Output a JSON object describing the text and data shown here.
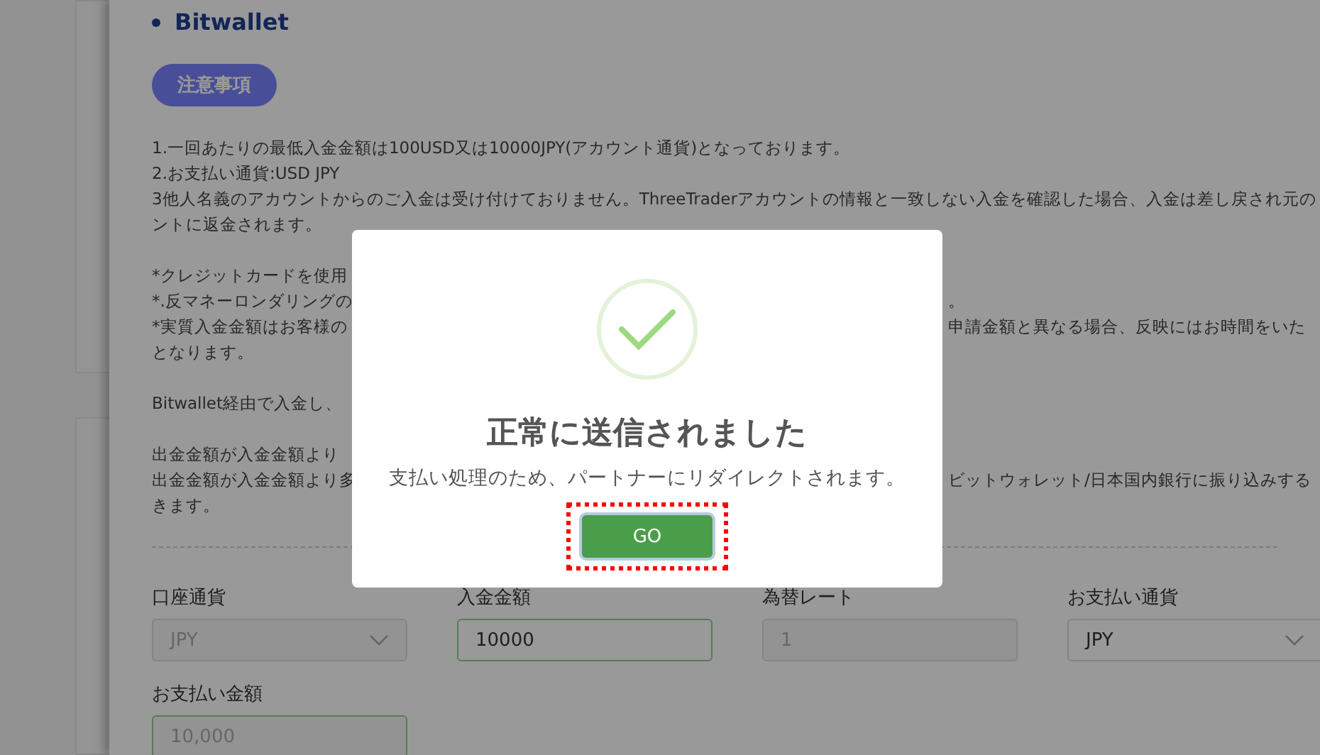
{
  "section": {
    "title": "Bitwallet",
    "notice_button": "注意事項"
  },
  "paragraphs": [
    [
      {
        "text": "1.一回あたりの最低入金金額は100USD又は10000JPY(アカウント通貨)となっております。"
      },
      {
        "text": "2.お支払い通貨:USD JPY"
      },
      {
        "text": "3他人名義のアカウントからのご入金は受け付けておりません。ThreeTraderアカウントの情報と一致しない入金を確認した場合、入金は差し戻され元の"
      },
      {
        "text": "ントに返金されます。"
      }
    ],
    [
      {
        "text": "*クレジットカードを使用"
      },
      {
        "text": "*.反マネーロンダリングの",
        "text_right": "。"
      },
      {
        "text": "*実質入金金額はお客様の",
        "text_right": "申請金額と異なる場合、反映にはお時間をいた"
      },
      {
        "text": "となります。"
      }
    ],
    [
      {
        "text": "Bitwallet経由で入金し、"
      }
    ],
    [
      {
        "text": "出金金額が入金金額より"
      },
      {
        "text": "出金金額が入金金額より多",
        "text_right": "ビットウォレット/日本国内銀行に振り込みする"
      },
      {
        "text": "きます。"
      }
    ]
  ],
  "form": [
    {
      "label": "口座通貨",
      "kind": "select",
      "value": "JPY",
      "disabled": true,
      "valid": false
    },
    {
      "label": "入金金額",
      "kind": "input",
      "value": "10000",
      "disabled": false,
      "valid": true
    },
    {
      "label": "為替レート",
      "kind": "input",
      "value": "1",
      "disabled": true,
      "valid": false
    },
    {
      "label": "お支払い通貨",
      "kind": "select",
      "value": "JPY",
      "disabled": false,
      "valid": false
    },
    {
      "label": "お支払い金額",
      "kind": "input",
      "value": "10,000",
      "disabled": true,
      "valid": true
    }
  ],
  "dialog": {
    "title": "正常に送信されました",
    "message": "支払い処理のため、パートナーにリダイレクトされます。",
    "button": "GO",
    "button_highlighted": true
  }
}
